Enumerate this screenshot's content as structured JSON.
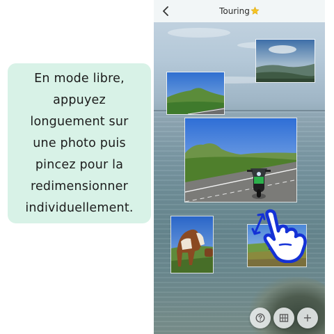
{
  "callout": {
    "text": "En mode libre,\nappuyez\nlonguement sur\nune photo puis\npincez pour la\nredimensionner\nindividuellement."
  },
  "header": {
    "title": "Touring",
    "title_emoji": "⭐",
    "back_icon": "chevron-left-icon"
  },
  "photos": [
    {
      "id": "coastal-highland-view",
      "subject": "hazy mountain landscape from coast"
    },
    {
      "id": "green-mountain-road",
      "subject": "green mountain beside road"
    },
    {
      "id": "motorcycle-on-road",
      "subject": "green motorcycle on mountain road"
    },
    {
      "id": "horse-in-field",
      "subject": "brown and white horse in pasture"
    },
    {
      "id": "cows-on-meadow",
      "subject": "cattle grazing on meadow"
    }
  ],
  "gesture": {
    "icon": "pinch-hand-icon",
    "arrow_icon": "resize-arrow-icon",
    "color": "#1431d6"
  },
  "toolbar": {
    "help_icon": "help-icon",
    "layout_icon": "grid-layout-icon",
    "add_icon": "add-icon",
    "add_label": "+"
  },
  "colors": {
    "callout_bg": "#d8f2e7",
    "header_bg": "#f2f6f7",
    "accent_blue": "#1431d6"
  }
}
